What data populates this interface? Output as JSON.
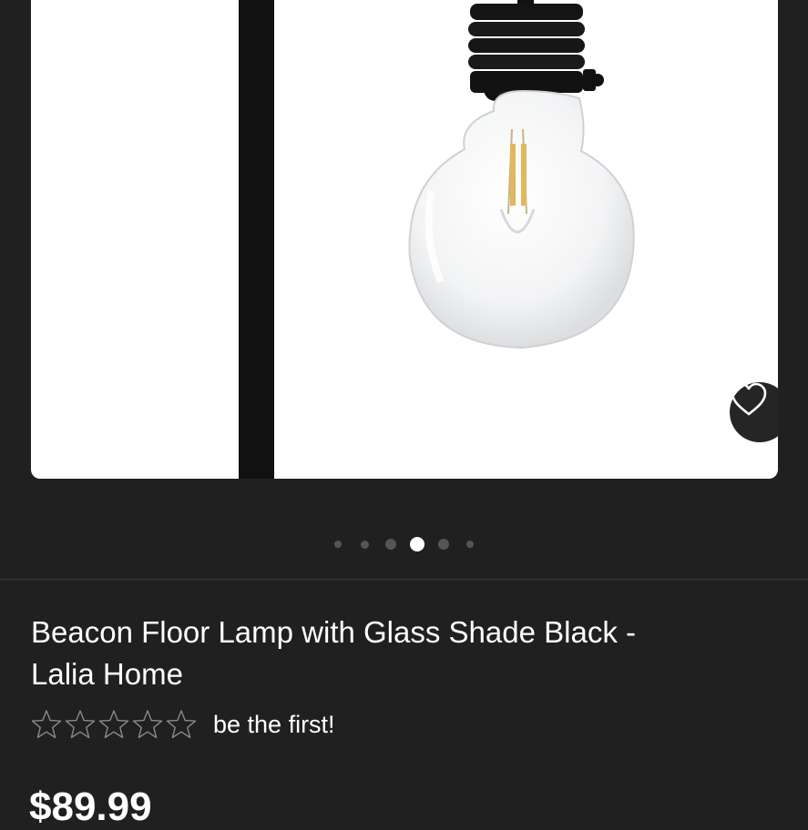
{
  "product": {
    "title_line1": "Beacon Floor Lamp with Glass Shade Black -",
    "title_line2": "Lalia Home",
    "rating_prompt": "be the first!",
    "star_count": 5,
    "price": "$89.99"
  },
  "gallery": {
    "image_icon": "floor-lamp-bulb-photo",
    "favorite_icon": "heart-icon",
    "dot_count": 6,
    "active_index": 3
  },
  "colors": {
    "background": "#202020",
    "card": "#ffffff",
    "lamp_metal": "#111111",
    "favorite_bg": "#252525",
    "dot_inactive": "#555555",
    "dot_active": "#ffffff"
  }
}
